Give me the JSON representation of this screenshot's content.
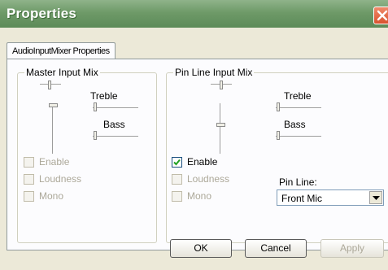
{
  "window": {
    "title": "Properties",
    "close_icon": "close-icon"
  },
  "tab": {
    "label": "AudioInputMixer Properties"
  },
  "master": {
    "legend": "Master Input Mix",
    "treble_label": "Treble",
    "bass_label": "Bass",
    "enable_label": "Enable",
    "loudness_label": "Loudness",
    "mono_label": "Mono",
    "enable_checked": false,
    "loudness_checked": false,
    "mono_checked": false
  },
  "pin": {
    "legend": "Pin Line Input Mix",
    "treble_label": "Treble",
    "bass_label": "Bass",
    "enable_label": "Enable",
    "loudness_label": "Loudness",
    "mono_label": "Mono",
    "enable_checked": true,
    "loudness_checked": false,
    "mono_checked": false,
    "pin_line_label": "Pin Line:",
    "pin_line_value": "Front Mic"
  },
  "buttons": {
    "ok": "OK",
    "cancel": "Cancel",
    "apply": "Apply"
  }
}
